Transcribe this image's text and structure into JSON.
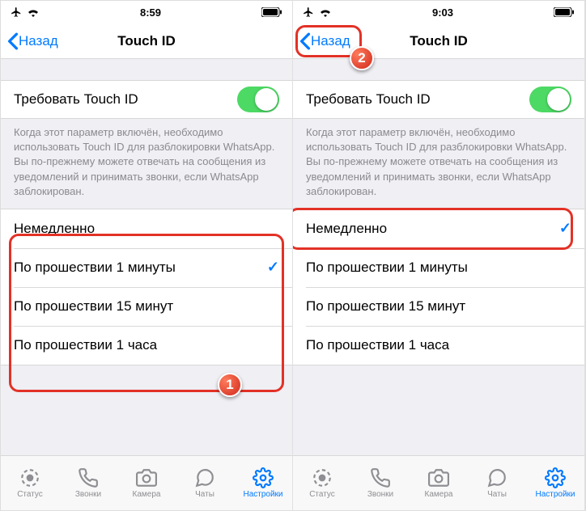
{
  "left": {
    "status": {
      "time": "8:59"
    },
    "nav": {
      "back": "Назад",
      "title": "Touch ID"
    },
    "require": {
      "label": "Требовать Touch ID",
      "on": true
    },
    "footer": "Когда этот параметр включён, необходимо использовать Touch ID для разблокировки WhatsApp. Вы по-прежнему можете отвечать на сообщения из уведомлений и принимать звонки, если WhatsApp заблокирован.",
    "options": [
      {
        "label": "Немедленно",
        "selected": false
      },
      {
        "label": "По прошествии 1 минуты",
        "selected": true
      },
      {
        "label": "По прошествии 15 минут",
        "selected": false
      },
      {
        "label": "По прошествии 1 часа",
        "selected": false
      }
    ],
    "annotation": "1"
  },
  "right": {
    "status": {
      "time": "9:03"
    },
    "nav": {
      "back": "Назад",
      "title": "Touch ID"
    },
    "require": {
      "label": "Требовать Touch ID",
      "on": true
    },
    "footer": "Когда этот параметр включён, необходимо использовать Touch ID для разблокировки WhatsApp. Вы по-прежнему можете отвечать на сообщения из уведомлений и принимать звонки, если WhatsApp заблокирован.",
    "options": [
      {
        "label": "Немедленно",
        "selected": true
      },
      {
        "label": "По прошествии 1 минуты",
        "selected": false
      },
      {
        "label": "По прошествии 15 минут",
        "selected": false
      },
      {
        "label": "По прошествии 1 часа",
        "selected": false
      }
    ],
    "annotation": "2"
  },
  "tabs": [
    {
      "label": "Статус",
      "icon": "status"
    },
    {
      "label": "Звонки",
      "icon": "calls"
    },
    {
      "label": "Камера",
      "icon": "camera"
    },
    {
      "label": "Чаты",
      "icon": "chats"
    },
    {
      "label": "Настройки",
      "icon": "settings",
      "active": true
    }
  ]
}
